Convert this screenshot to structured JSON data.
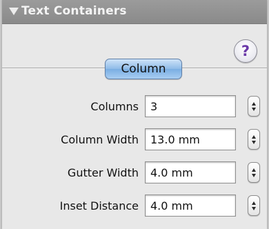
{
  "panel": {
    "title": "Text Containers",
    "help_label": "?",
    "tab_label": "Column"
  },
  "fields": [
    {
      "label": "Columns",
      "value": "3"
    },
    {
      "label": "Column Width",
      "value": "13.0 mm"
    },
    {
      "label": "Gutter Width",
      "value": "4.0 mm"
    },
    {
      "label": "Inset Distance",
      "value": "4.0 mm"
    }
  ],
  "icons": {
    "disclosure": "disclosure-triangle-down-icon",
    "help": "help-question-icon",
    "stepper": "stepper-arrows-icon"
  },
  "colors": {
    "tab_accent": "#8fbbe8",
    "help_glyph": "#6a38a8",
    "titlebar": "#8a8a8a"
  }
}
